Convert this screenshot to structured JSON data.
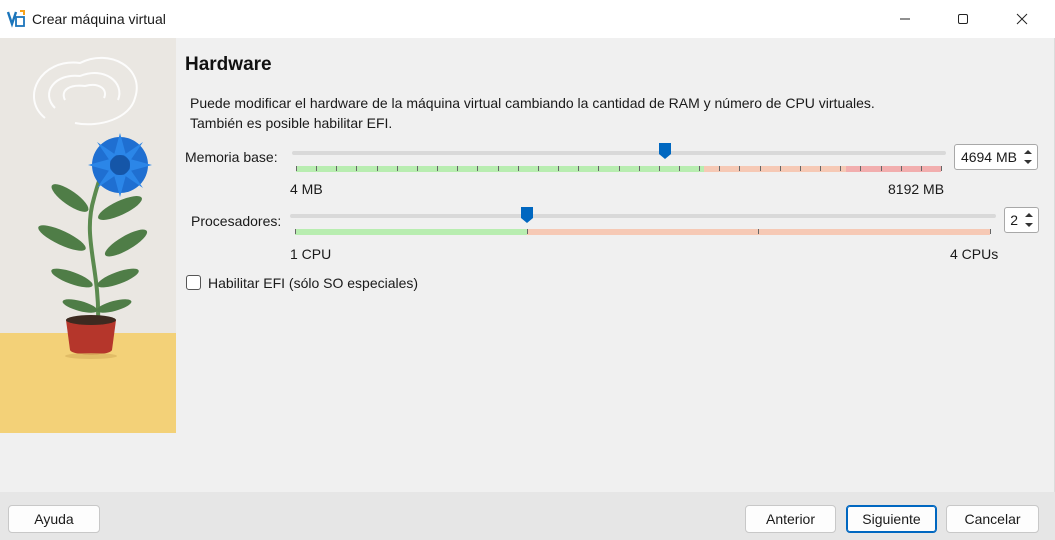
{
  "window": {
    "title": "Crear máquina virtual",
    "icon": "virtualbox-icon",
    "controls": [
      "minimize-icon",
      "maximize-icon",
      "close-icon"
    ]
  },
  "page": {
    "heading": "Hardware",
    "description_line1": "Puede modificar el hardware de la máquina virtual cambiando la cantidad de RAM y número de CPU virtuales.",
    "description_line2": "También es posible habilitar EFI."
  },
  "memory": {
    "label": "Memoria base:",
    "value": "4694 MB",
    "min_label": "4 MB",
    "max_label": "8192 MB",
    "min": 4,
    "max": 8192,
    "current": 4694
  },
  "processors": {
    "label": "Procesadores:",
    "value": "2",
    "min_label": "1 CPU",
    "max_label": "4 CPUs",
    "min": 1,
    "max": 4,
    "current": 2
  },
  "efi": {
    "label": "Habilitar EFI (sólo SO especiales)",
    "checked": false
  },
  "buttons": {
    "help": "Ayuda",
    "back": "Anterior",
    "next": "Siguiente",
    "cancel": "Cancelar"
  },
  "colors": {
    "accent": "#0067c0",
    "zone_green": "#b8edb0",
    "zone_orange": "#f6c9b5",
    "zone_red": "#f2aeae"
  }
}
